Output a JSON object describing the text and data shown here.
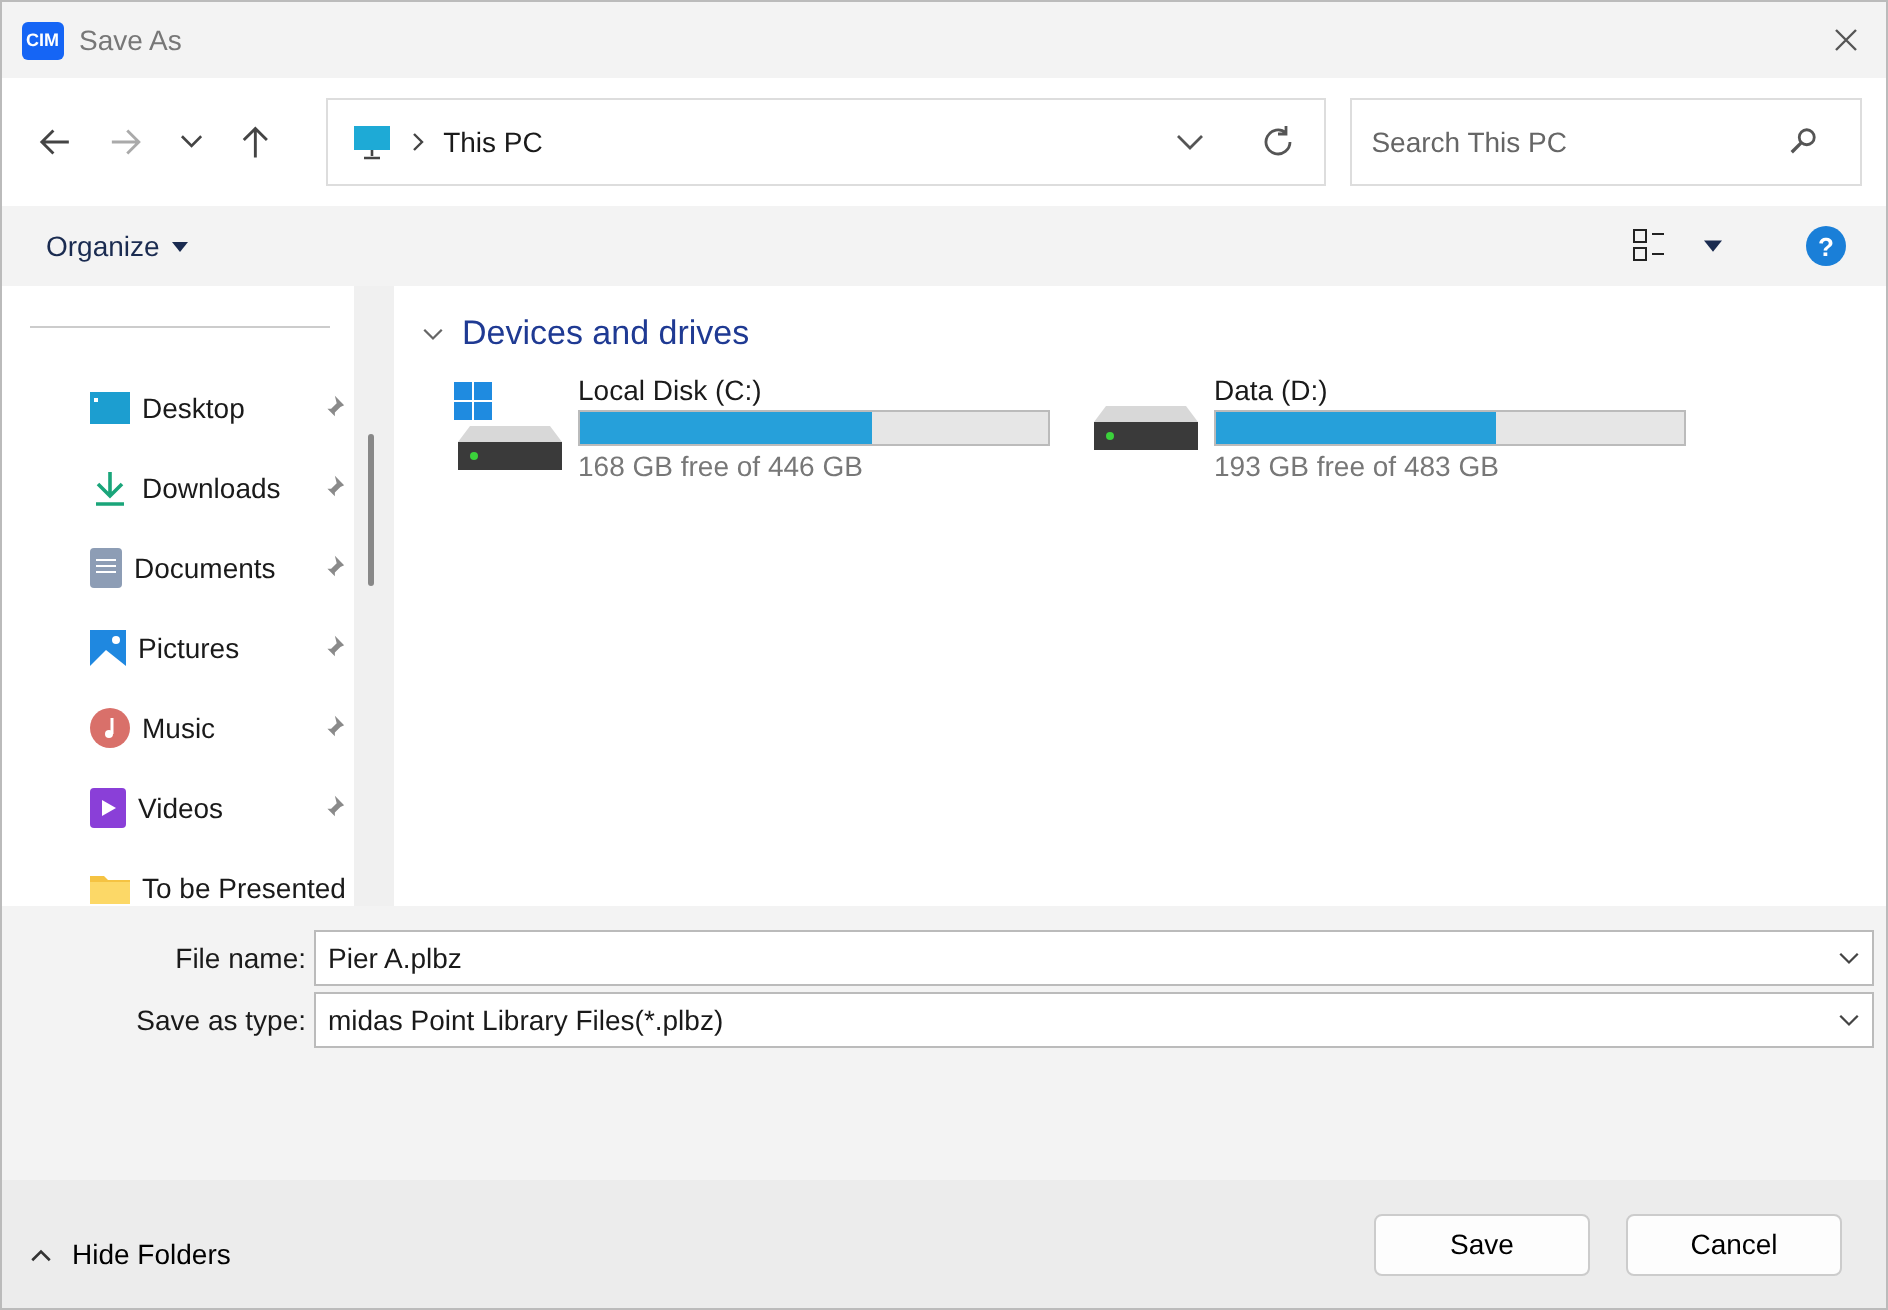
{
  "window": {
    "title": "Save As",
    "app_badge": "CIM"
  },
  "nav": {
    "back_disabled": false,
    "forward_disabled": true,
    "up_disabled": false,
    "address": "This PC",
    "search": {
      "placeholder": "Search This PC"
    }
  },
  "toolbar": {
    "organize": "Organize",
    "help": "?"
  },
  "sidebar": {
    "items": [
      {
        "kind": "desktop",
        "label": "Desktop",
        "pinned": true
      },
      {
        "kind": "downloads",
        "label": "Downloads",
        "pinned": true
      },
      {
        "kind": "documents",
        "label": "Documents",
        "pinned": true
      },
      {
        "kind": "pictures",
        "label": "Pictures",
        "pinned": true
      },
      {
        "kind": "music",
        "label": "Music",
        "pinned": true
      },
      {
        "kind": "videos",
        "label": "Videos",
        "pinned": true
      },
      {
        "kind": "folder",
        "label": "To be Presented",
        "pinned": false
      }
    ]
  },
  "section": {
    "title": "Devices and drives",
    "expanded": true,
    "drives": [
      {
        "name": "Local Disk (C:)",
        "system": true,
        "level": 0.623,
        "free": "168 GB free of 446 GB"
      },
      {
        "name": "Data (D:)",
        "system": false,
        "level": 0.6,
        "free": "193 GB free of 483 GB"
      }
    ]
  },
  "form": {
    "file_name_label": "File name:",
    "file_name": "Pier A.plbz",
    "type_label": "Save as type:",
    "type": "midas Point Library Files(*.plbz)"
  },
  "footer": {
    "hide_folders": "Hide Folders",
    "save": "Save",
    "cancel": "Cancel"
  }
}
